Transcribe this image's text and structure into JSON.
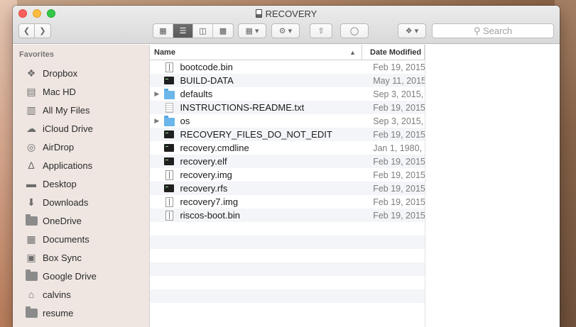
{
  "window": {
    "title": "RECOVERY"
  },
  "toolbar": {
    "search_placeholder": "Search"
  },
  "sidebar": {
    "heading": "Favorites",
    "items": [
      {
        "label": "Dropbox",
        "icon": "dropbox-icon"
      },
      {
        "label": "Mac HD",
        "icon": "hard-drive-icon"
      },
      {
        "label": "All My Files",
        "icon": "all-files-icon"
      },
      {
        "label": "iCloud Drive",
        "icon": "cloud-icon"
      },
      {
        "label": "AirDrop",
        "icon": "airdrop-icon"
      },
      {
        "label": "Applications",
        "icon": "applications-icon"
      },
      {
        "label": "Desktop",
        "icon": "desktop-icon"
      },
      {
        "label": "Downloads",
        "icon": "downloads-icon"
      },
      {
        "label": "OneDrive",
        "icon": "folder-icon"
      },
      {
        "label": "Documents",
        "icon": "documents-icon"
      },
      {
        "label": "Box Sync",
        "icon": "box-icon"
      },
      {
        "label": "Google Drive",
        "icon": "folder-icon"
      },
      {
        "label": "calvins",
        "icon": "home-icon"
      },
      {
        "label": "resume",
        "icon": "folder-icon"
      }
    ]
  },
  "columns": {
    "name": "Name",
    "date": "Date Modified"
  },
  "files": [
    {
      "name": "bootcode.bin",
      "date": "Feb 19, 2015",
      "kind": "doc"
    },
    {
      "name": "BUILD-DATA",
      "date": "May 11, 2015",
      "kind": "exec"
    },
    {
      "name": "defaults",
      "date": "Sep 3, 2015,",
      "kind": "folder"
    },
    {
      "name": "INSTRUCTIONS-README.txt",
      "date": "Feb 19, 2015",
      "kind": "txt"
    },
    {
      "name": "os",
      "date": "Sep 3, 2015,",
      "kind": "folder"
    },
    {
      "name": "RECOVERY_FILES_DO_NOT_EDIT",
      "date": "Feb 19, 2015",
      "kind": "exec"
    },
    {
      "name": "recovery.cmdline",
      "date": "Jan 1, 1980,",
      "kind": "exec"
    },
    {
      "name": "recovery.elf",
      "date": "Feb 19, 2015",
      "kind": "exec"
    },
    {
      "name": "recovery.img",
      "date": "Feb 19, 2015",
      "kind": "doc"
    },
    {
      "name": "recovery.rfs",
      "date": "Feb 19, 2015",
      "kind": "exec"
    },
    {
      "name": "recovery7.img",
      "date": "Feb 19, 2015",
      "kind": "doc"
    },
    {
      "name": "riscos-boot.bin",
      "date": "Feb 19, 2015",
      "kind": "doc"
    }
  ]
}
